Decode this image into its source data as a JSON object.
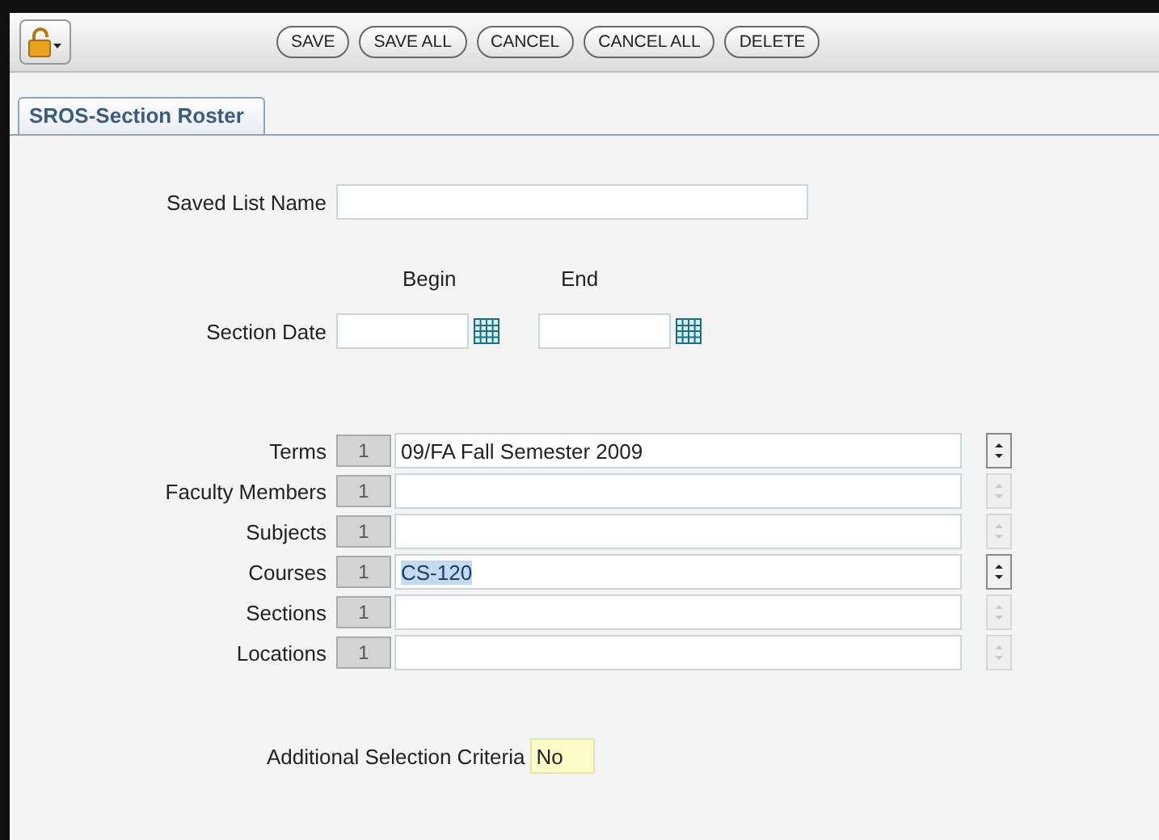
{
  "toolbar": {
    "buttons": [
      "SAVE",
      "SAVE ALL",
      "CANCEL",
      "CANCEL ALL",
      "DELETE"
    ]
  },
  "tabs": [
    {
      "label": "SROS-Section Roster",
      "selected": true
    }
  ],
  "saved_list_name": {
    "label": "Saved List Name"
  },
  "section_date": {
    "label": "Section Date",
    "begin_label": "Begin",
    "end_label": "End"
  },
  "lists": [
    {
      "label": "Terms",
      "count": "1",
      "value": "09/FA Fall Semester 2009",
      "value_selected": false,
      "spinner_enabled": true
    },
    {
      "label": "Faculty Members",
      "count": "1",
      "spinner_enabled": false
    },
    {
      "label": "Subjects",
      "count": "1",
      "spinner_enabled": false
    },
    {
      "label": "Courses",
      "count": "1",
      "value": "CS-120",
      "value_selected": true,
      "spinner_enabled": true
    },
    {
      "label": "Sections",
      "count": "1",
      "spinner_enabled": false
    },
    {
      "label": "Locations",
      "count": "1",
      "spinner_enabled": false
    }
  ],
  "additional_criteria": {
    "label": "Additional Selection Criteria",
    "value": "No"
  }
}
